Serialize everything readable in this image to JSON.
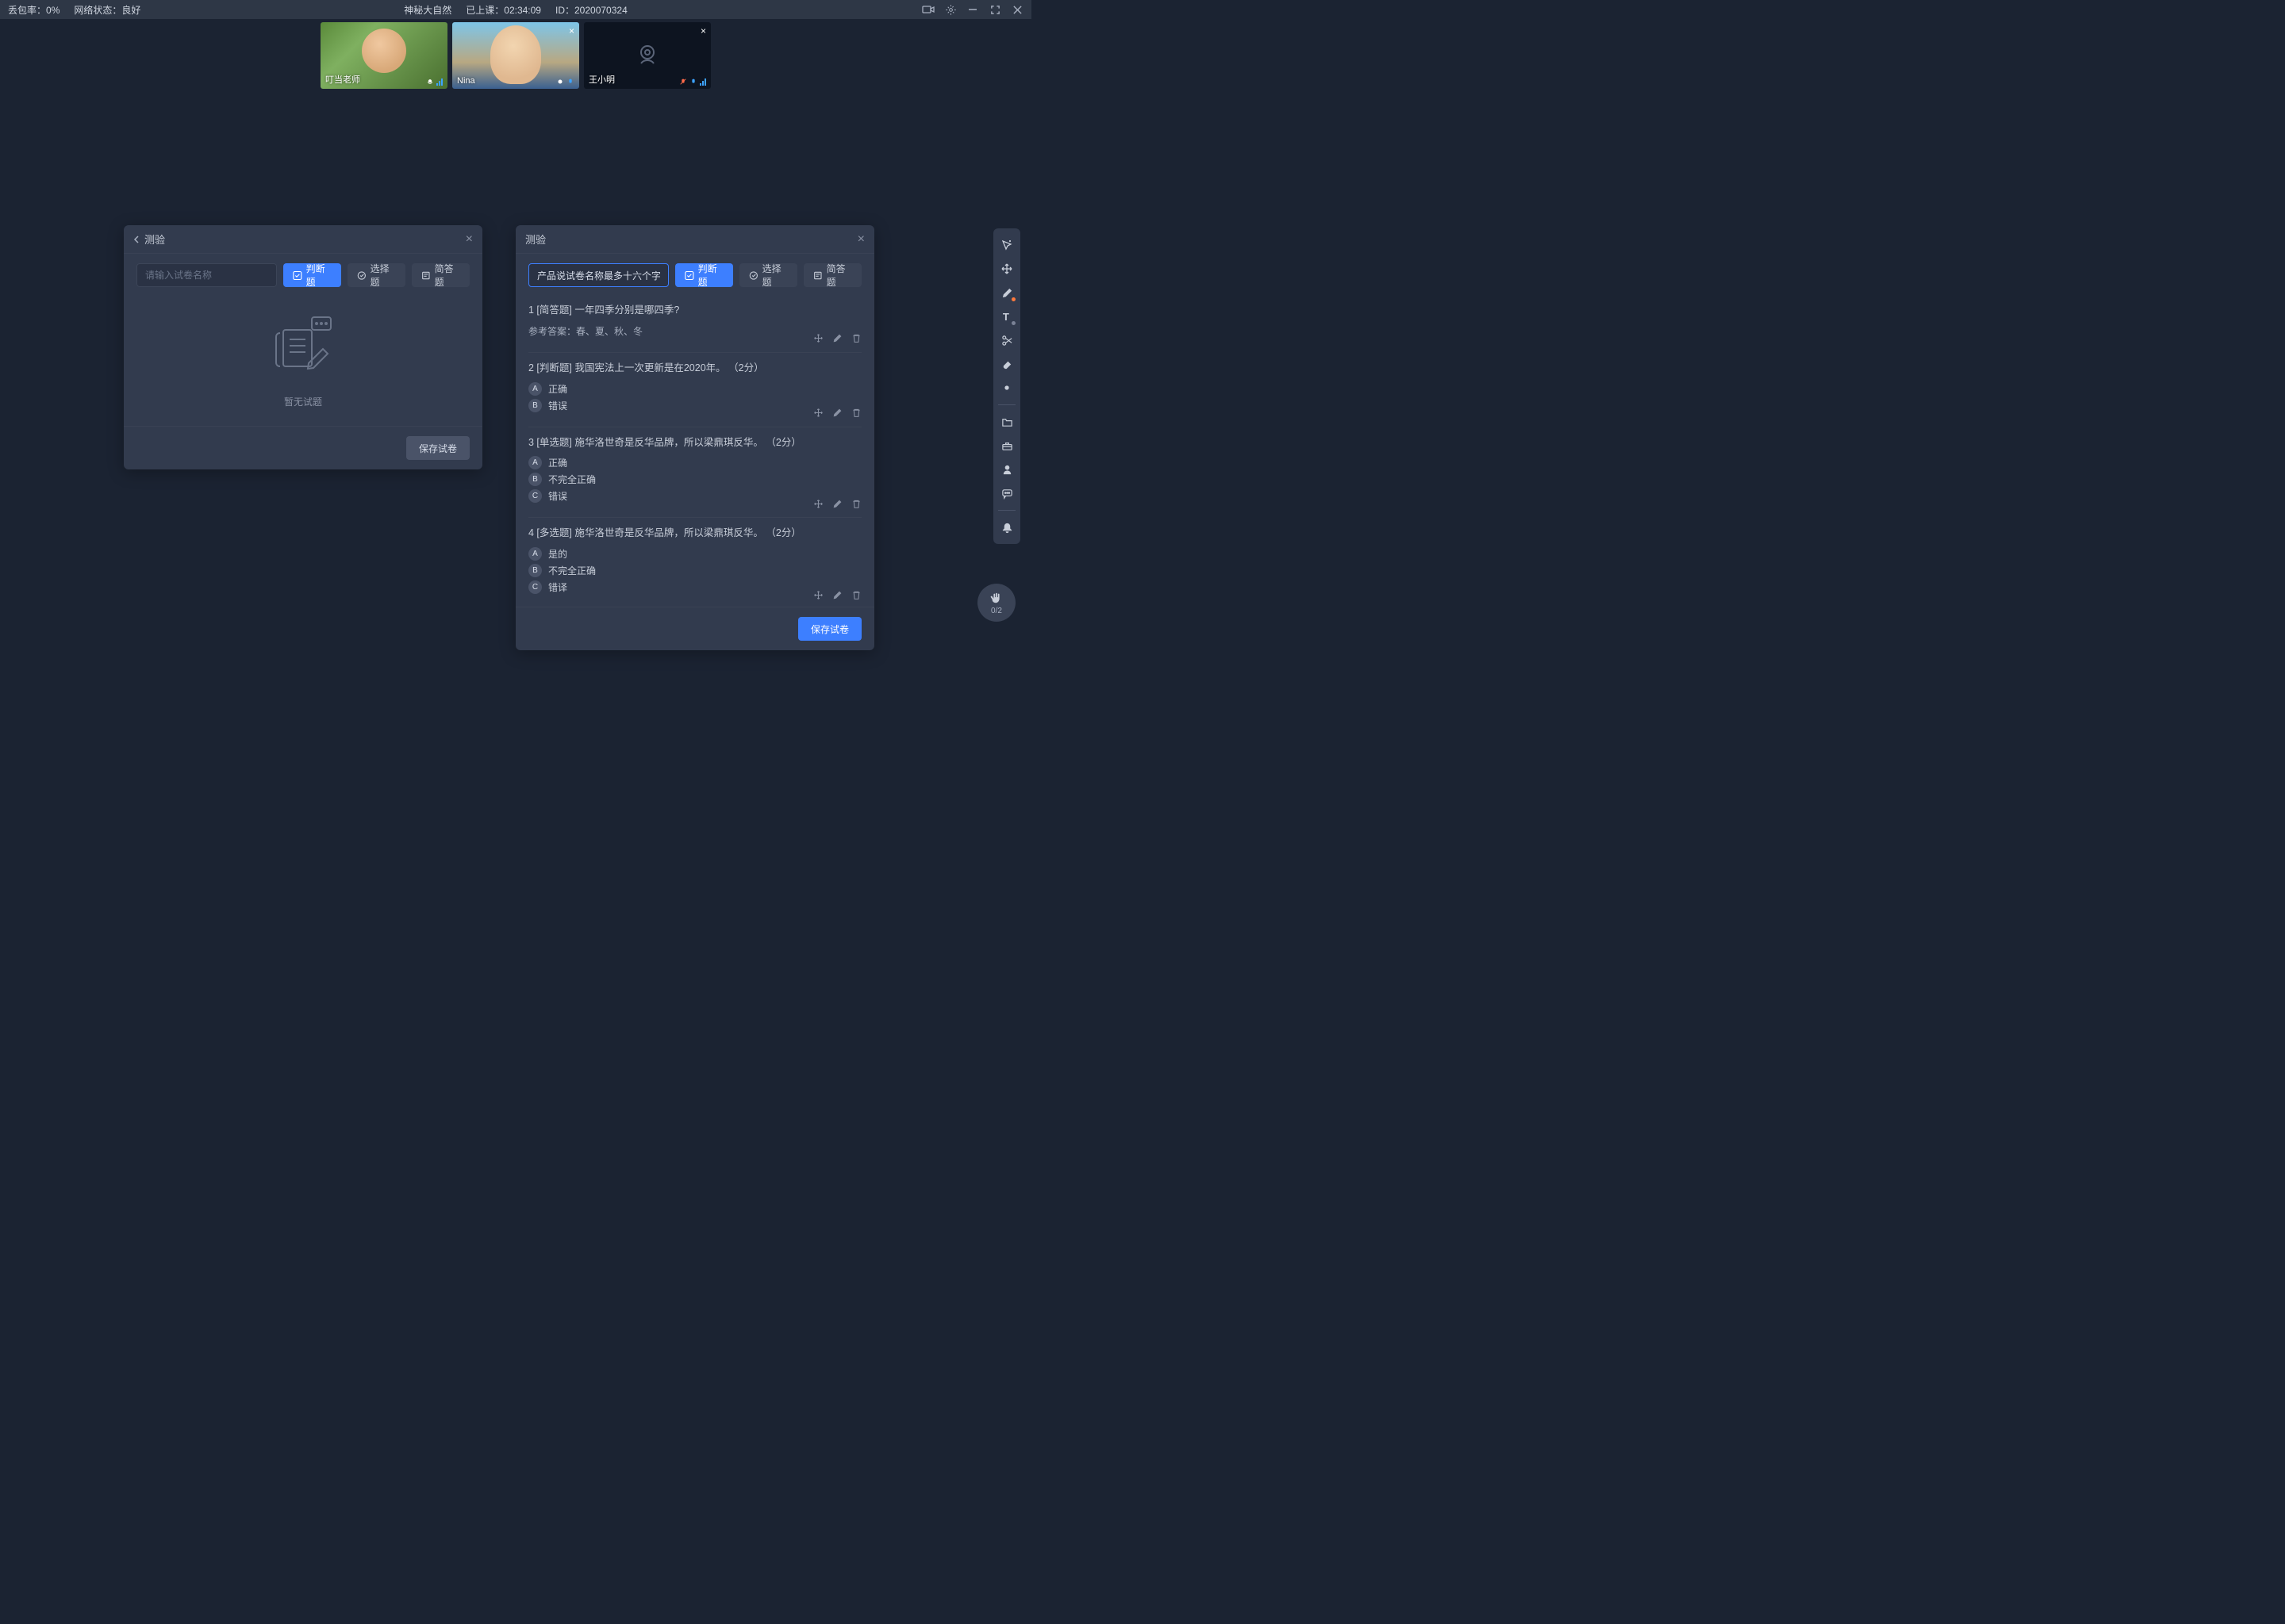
{
  "topbar": {
    "packet_loss_label": "丢包率：",
    "packet_loss_value": "0%",
    "network_label": "网络状态：",
    "network_value": "良好",
    "course_title": "神秘大自然",
    "elapsed_label": "已上课：",
    "elapsed_value": "02:34:09",
    "id_label": "ID：",
    "id_value": "2020070324"
  },
  "videos": [
    {
      "name": "叮当老师",
      "camera_on": true
    },
    {
      "name": "Nina",
      "camera_on": true
    },
    {
      "name": "王小明",
      "camera_on": false
    }
  ],
  "left_panel": {
    "title": "测验",
    "name_placeholder": "请输入试卷名称",
    "name_value": "",
    "chips": {
      "tf": "判断题",
      "choice": "选择题",
      "short": "简答题"
    },
    "empty_text": "暂无试题",
    "save_label": "保存试卷"
  },
  "right_panel": {
    "title": "测验",
    "name_value": "产品说试卷名称最多十六个字",
    "chips": {
      "tf": "判断题",
      "choice": "选择题",
      "short": "简答题"
    },
    "save_label": "保存试卷",
    "questions": [
      {
        "title": "1 [简答题] 一年四季分别是哪四季?",
        "answer_label": "参考答案：春、夏、秋、冬",
        "options": []
      },
      {
        "title": "2 [判断题] 我国宪法上一次更新是在2020年。 （2分）",
        "options": [
          {
            "letter": "A",
            "text": "正确"
          },
          {
            "letter": "B",
            "text": "错误"
          }
        ]
      },
      {
        "title": "3 [单选题] 施华洛世奇是反华品牌，所以梁鼎琪反华。 （2分）",
        "options": [
          {
            "letter": "A",
            "text": "正确"
          },
          {
            "letter": "B",
            "text": "不完全正确"
          },
          {
            "letter": "C",
            "text": "错误"
          }
        ]
      },
      {
        "title": "4 [多选题] 施华洛世奇是反华品牌，所以梁鼎琪反华。 （2分）",
        "options": [
          {
            "letter": "A",
            "text": "是的"
          },
          {
            "letter": "B",
            "text": "不完全正确"
          },
          {
            "letter": "C",
            "text": "错译"
          }
        ]
      }
    ]
  },
  "hand": {
    "count": "0/2"
  }
}
